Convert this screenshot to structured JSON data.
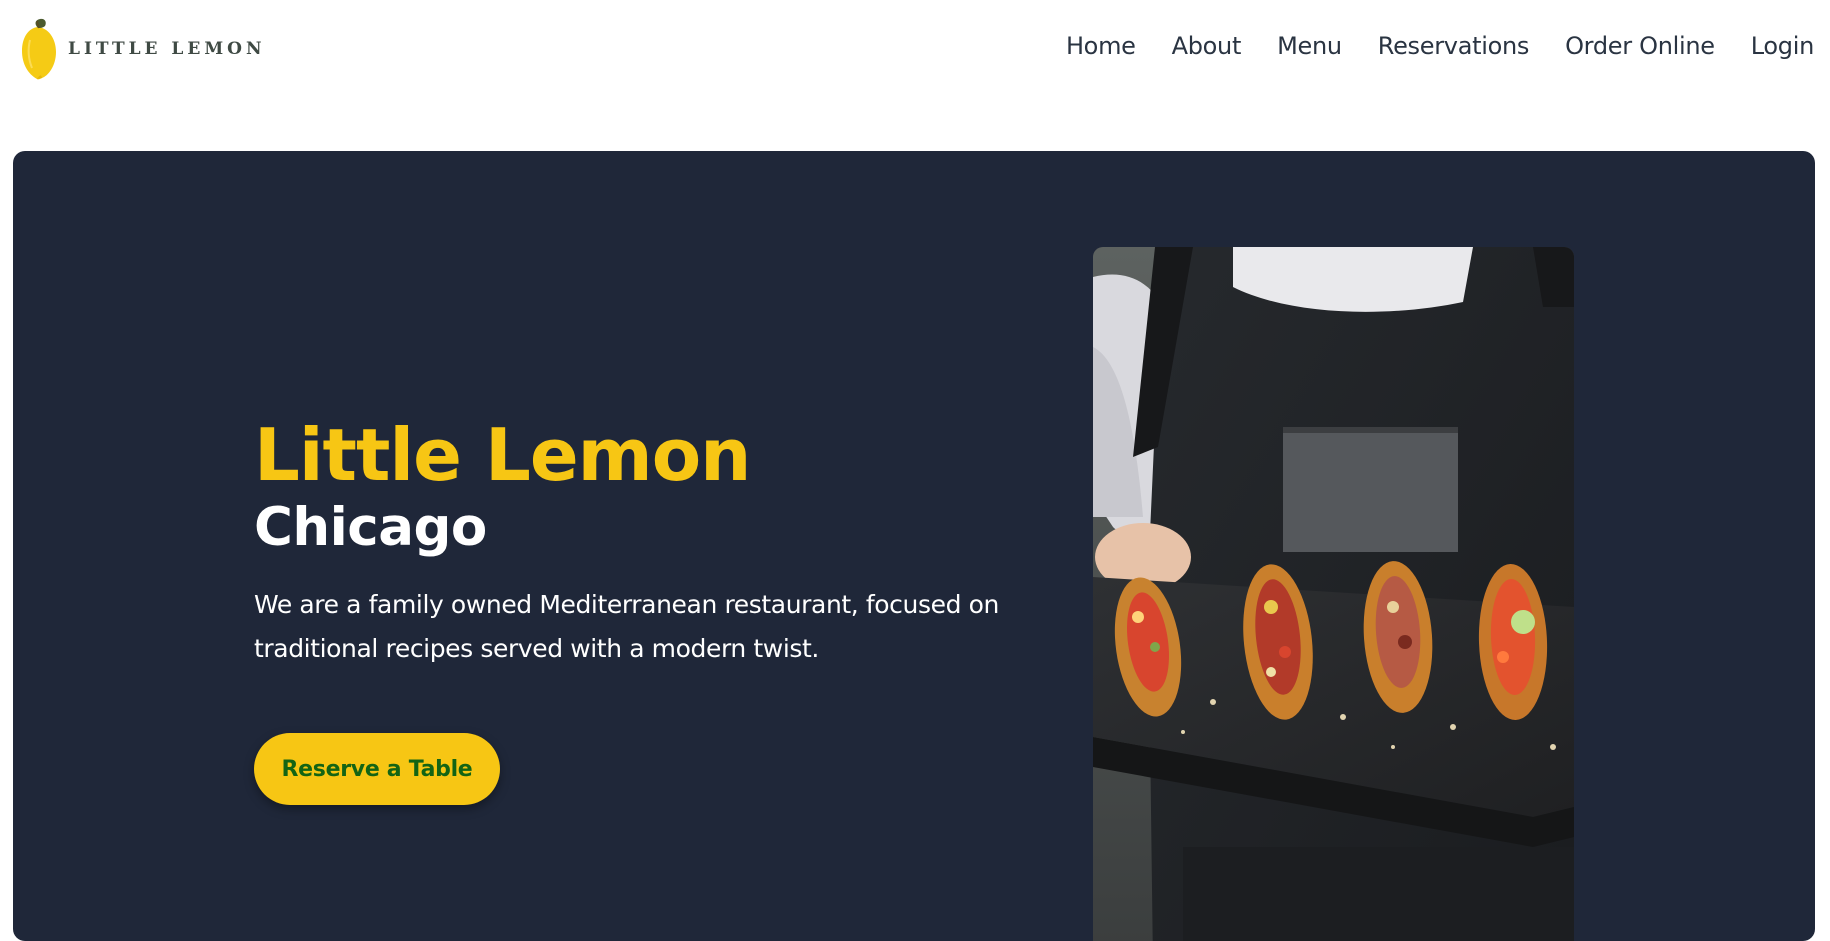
{
  "brand": {
    "logo_text": "LITTLE LEMON",
    "logo_icon": "lemon-icon",
    "accent_color": "#f7c614"
  },
  "nav": {
    "items": [
      {
        "label": "Home"
      },
      {
        "label": "About"
      },
      {
        "label": "Menu"
      },
      {
        "label": "Reservations"
      },
      {
        "label": "Order Online"
      },
      {
        "label": "Login"
      }
    ]
  },
  "hero": {
    "background_color": "#1f2739",
    "title": "Little Lemon",
    "subtitle": "Chicago",
    "description": "We are a family owned Mediterranean restaurant, focused on traditional recipes served with a modern twist.",
    "button_label": "Reserve a Table",
    "button_text_color": "#146414",
    "image_subject": "bruschetta-platter-photo"
  }
}
